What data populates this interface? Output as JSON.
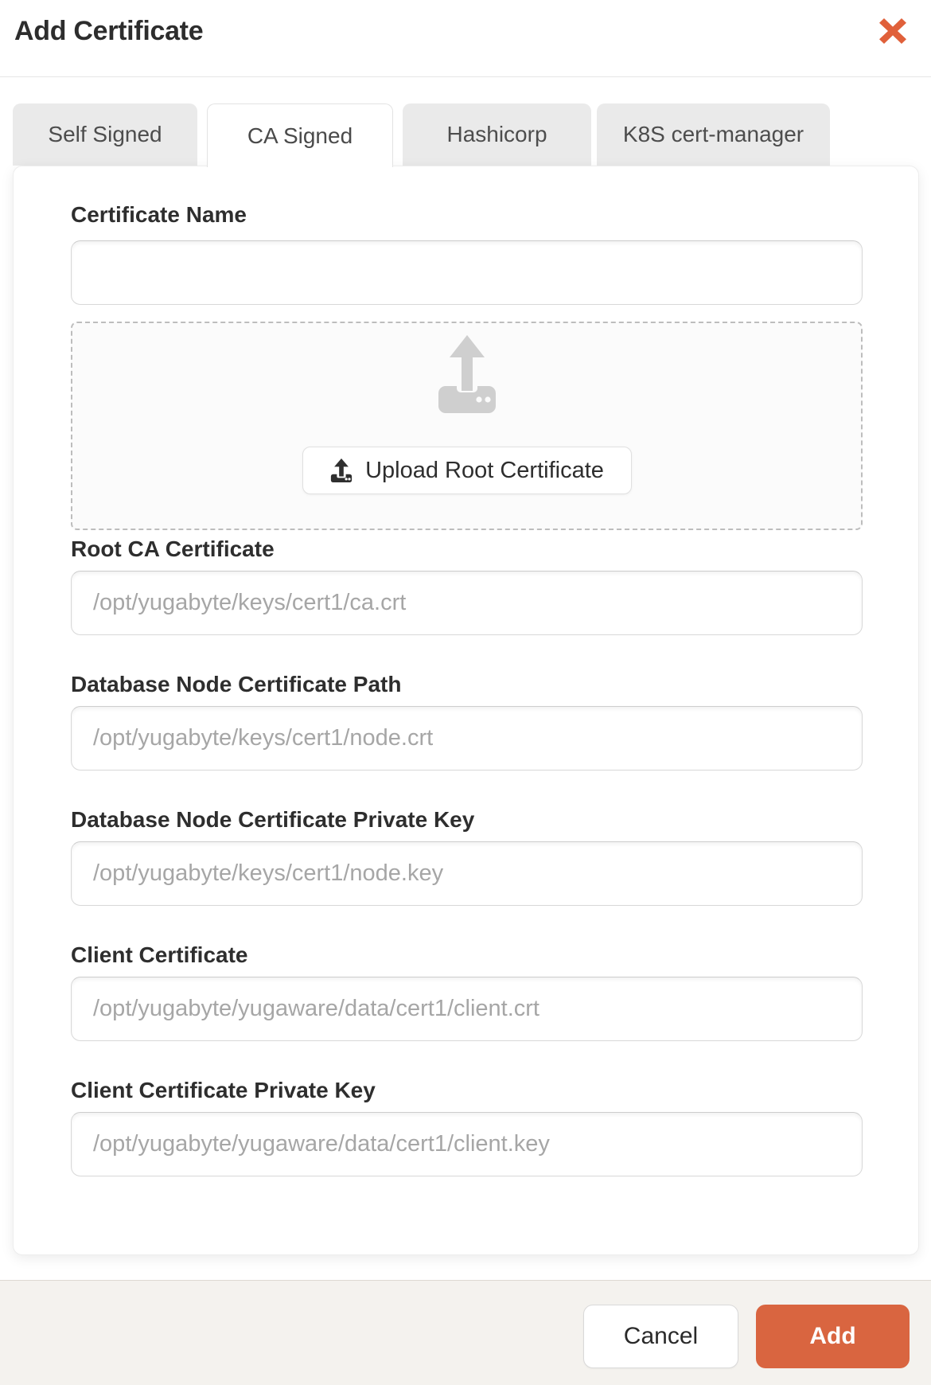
{
  "header": {
    "title": "Add Certificate"
  },
  "tabs": [
    {
      "label": "Self Signed",
      "active": false
    },
    {
      "label": "CA Signed",
      "active": true
    },
    {
      "label": "Hashicorp",
      "active": false
    },
    {
      "label": "K8S cert-manager",
      "active": false
    }
  ],
  "form": {
    "certificate_name": {
      "label": "Certificate Name",
      "value": "",
      "placeholder": ""
    },
    "upload": {
      "button_label": "Upload Root Certificate"
    },
    "fields": [
      {
        "label": "Root CA Certificate",
        "placeholder": "/opt/yugabyte/keys/cert1/ca.crt"
      },
      {
        "label": "Database Node Certificate Path",
        "placeholder": "/opt/yugabyte/keys/cert1/node.crt"
      },
      {
        "label": "Database Node Certificate Private Key",
        "placeholder": "/opt/yugabyte/keys/cert1/node.key"
      },
      {
        "label": "Client Certificate",
        "placeholder": "/opt/yugabyte/yugaware/data/cert1/client.crt"
      },
      {
        "label": "Client Certificate Private Key",
        "placeholder": "/opt/yugabyte/yugaware/data/cert1/client.key"
      }
    ]
  },
  "footer": {
    "cancel_label": "Cancel",
    "add_label": "Add"
  },
  "colors": {
    "accent_orange": "#d96540",
    "close_icon_orange": "#e0603a",
    "footer_background": "#f4f2ee",
    "inactive_tab_background": "#eaeaea"
  },
  "icons": {
    "close": "close-icon",
    "upload_large": "upload-icon",
    "upload_small": "upload-icon"
  }
}
